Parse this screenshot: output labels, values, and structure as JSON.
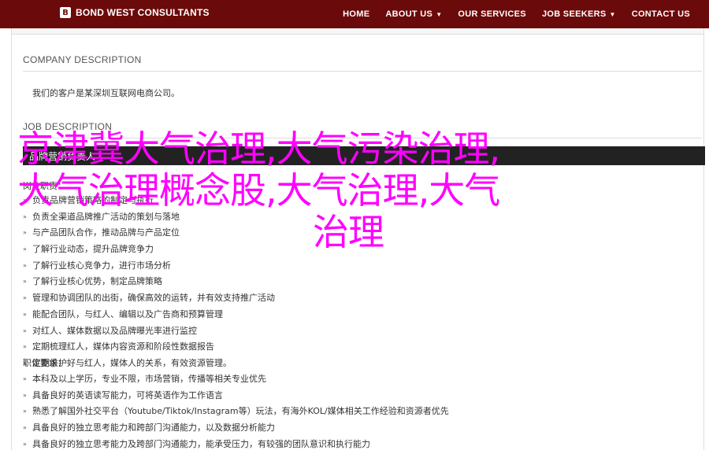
{
  "header": {
    "logo_text": "BOND WEST CONSULTANTS",
    "logo_mark": "B",
    "nav": [
      {
        "label": "HOME",
        "has_dropdown": false
      },
      {
        "label": "ABOUT US",
        "has_dropdown": true
      },
      {
        "label": "OUR SERVICES",
        "has_dropdown": false
      },
      {
        "label": "JOB SEEKERS",
        "has_dropdown": true
      },
      {
        "label": "CONTACT US",
        "has_dropdown": false
      }
    ]
  },
  "company": {
    "title": "COMPANY DESCRIPTION",
    "text": "我们的客户是某深圳互联网电商公司。"
  },
  "job": {
    "title": "JOB DESCRIPTION",
    "bar_label": "品牌营销负责人",
    "duties_label": "岗位职责：",
    "duties": [
      "负责品牌营销策略的制定与执行",
      "负责全渠道品牌推广活动的策划与落地",
      "与产品团队合作，推动品牌与产品定位",
      "了解行业动态，提升品牌竞争力",
      "了解行业核心竞争力，进行市场分析",
      "了解行业核心优势，制定品牌策略",
      "管理和协调团队的出街，确保高效的运转，并有效支持推广活动",
      "能配合团队，与红人、编辑以及广告商和预算管理",
      "对红人、媒体数据以及品牌曝光率进行监控",
      "定期梳理红人，媒体内容资源和阶段性数据报告",
      "定期维护好与红人，媒体人的关系，有效资源管理。"
    ],
    "reqs_label": "职位要求：",
    "reqs": [
      "本科及以上学历，专业不限，市场营销，传播等相关专业优先",
      "具备良好的英语读写能力，可将英语作为工作语言",
      "熟悉了解国外社交平台（Youtube/Tiktok/Instagram等）玩法，有海外KOL/媒体相关工作经验和资源者优先",
      "具备良好的独立思考能力和跨部门沟通能力，以及数据分析能力",
      "具备良好的独立思考能力及跨部门沟通能力，能承受压力，有较强的团队意识和执行能力"
    ]
  },
  "overlay": {
    "line1": "京津冀大气治理,大气污染治理,",
    "line2": "大气治理概念股,大气治理,大气",
    "line3": "治理"
  },
  "colors": {
    "nav_bg": "#6b0a0a",
    "bar_bg": "#222222",
    "overlay": "#ff00ff"
  }
}
